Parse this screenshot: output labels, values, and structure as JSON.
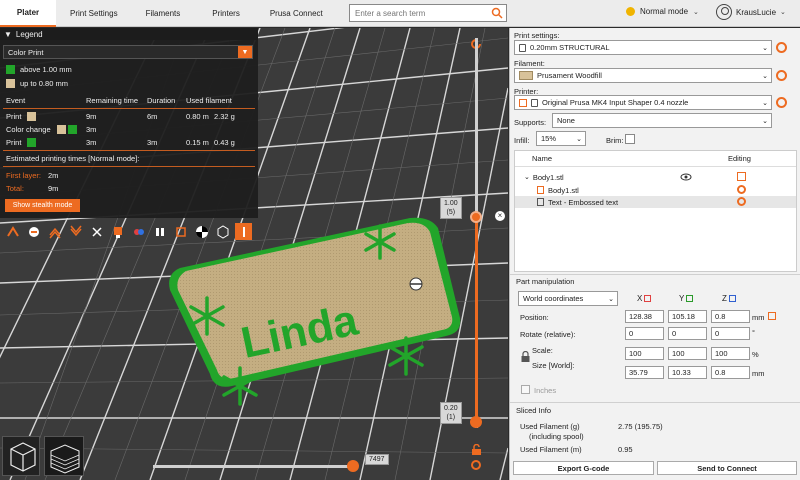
{
  "tabs": [
    "Plater",
    "Print Settings",
    "Filaments",
    "Printers",
    "Prusa Connect"
  ],
  "search": {
    "placeholder": "Enter a search term"
  },
  "mode": {
    "label": "Normal mode",
    "color": "#f0b400"
  },
  "user": {
    "name": "KrausLucie"
  },
  "legend": {
    "title": "Legend",
    "view_type": "Color Print",
    "ranges": [
      "above 1.00 mm",
      "up to 0.80 mm"
    ],
    "headers": [
      "Event",
      "Remaining time",
      "Duration",
      "Used filament"
    ],
    "rows": [
      {
        "event": "Print",
        "remaining": "9m",
        "duration": "6m",
        "used_m": "0.80 m",
        "used_g": "2.32 g"
      },
      {
        "event": "Color change",
        "remaining": "3m",
        "duration": "",
        "used_m": "",
        "used_g": ""
      },
      {
        "event": "Print",
        "remaining": "3m",
        "duration": "3m",
        "used_m": "0.15 m",
        "used_g": "0.43 g"
      }
    ],
    "estimated_title": "Estimated printing times [Normal mode]:",
    "first_layer_label": "First layer:",
    "first_layer_value": "2m",
    "total_label": "Total:",
    "total_value": "9m",
    "stealth_button": "Show stealth mode"
  },
  "model_text": "Linda",
  "vertical_slider": {
    "top_value": "1.00",
    "top_layer": "(5)",
    "bottom_value": "0.20",
    "bottom_layer": "(1)"
  },
  "horizontal_slider": {
    "value": "7497"
  },
  "panel": {
    "print_settings_label": "Print settings:",
    "print_settings_value": "0.20mm STRUCTURAL",
    "filament_label": "Filament:",
    "filament_value": "Prusament Woodfill",
    "filament_color": "#d8c29a",
    "printer_label": "Printer:",
    "printer_value": "Original Prusa MK4 Input Shaper 0.4 nozzle",
    "supports_label": "Supports:",
    "supports_value": "None",
    "infill_label": "Infill:",
    "infill_value": "15%",
    "brim_label": "Brim:",
    "tree_headers": [
      "Name",
      "Editing"
    ],
    "objects": [
      {
        "name": "Body1.stl",
        "level": 0
      },
      {
        "name": "Body1.stl",
        "level": 1
      },
      {
        "name": "Text - Embossed text",
        "level": 1
      }
    ],
    "part_manipulation_title": "Part manipulation",
    "coord_system": "World coordinates",
    "axes": [
      "X",
      "Y",
      "Z"
    ],
    "position_label": "Position:",
    "position": [
      "128.38",
      "105.18",
      "0.8"
    ],
    "rotate_label": "Rotate (relative):",
    "rotate": [
      "0",
      "0",
      "0"
    ],
    "scale_label": "Scale:",
    "scale": [
      "100",
      "100",
      "100"
    ],
    "size_label": "Size [World]:",
    "size": [
      "35.79",
      "10.33",
      "0.8"
    ],
    "unit_mm": "mm",
    "unit_deg": "°",
    "unit_pct": "%",
    "inches_label": "Inches",
    "sliced_info_title": "Sliced Info",
    "used_filament_g_label": "Used Filament (g)",
    "used_filament_g_sub": "(including spool)",
    "used_filament_g_value": "2.75 (195.75)",
    "used_filament_m_label": "Used Filament (m)",
    "used_filament_m_value": "0.95",
    "export_button": "Export G-code",
    "send_button": "Send to Connect"
  },
  "colors": {
    "accent": "#ed6b21",
    "green": "#22a52a",
    "tan": "#d8c29a"
  }
}
